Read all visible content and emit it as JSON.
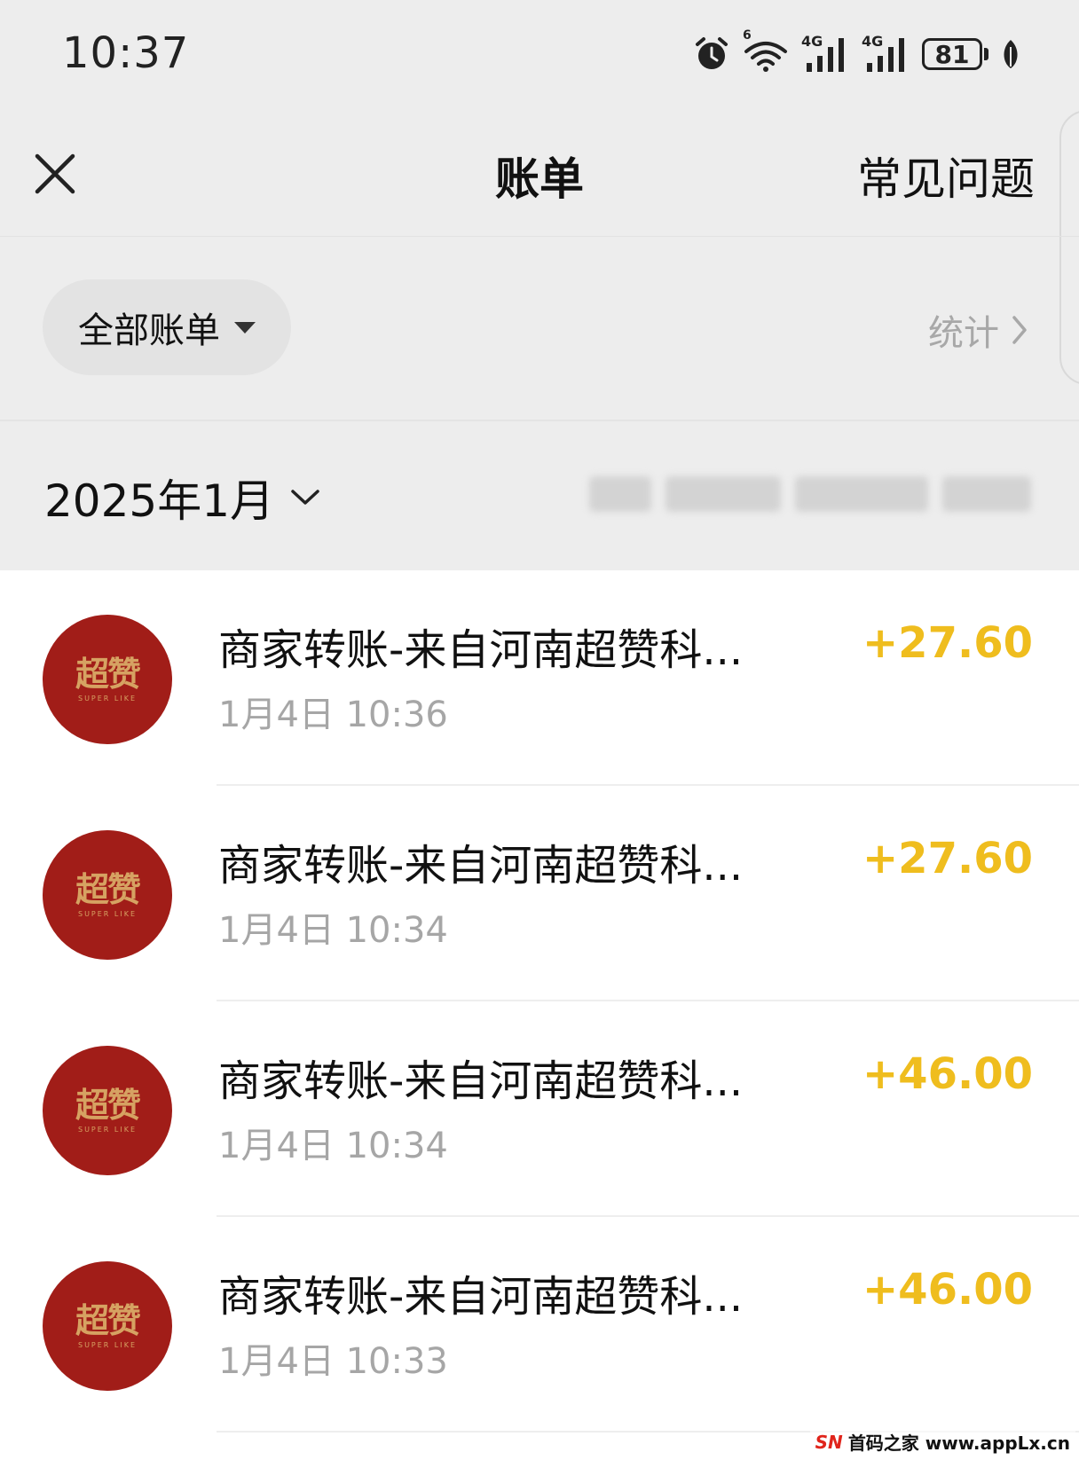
{
  "status_bar": {
    "time": "10:37",
    "battery": "81",
    "network_1": "4G",
    "network_2": "4G",
    "wifi_badge": "6"
  },
  "nav": {
    "title": "账单",
    "faq": "常见问题"
  },
  "filter": {
    "label": "全部账单",
    "stats": "统计"
  },
  "month": {
    "label": "2025年1月"
  },
  "bills": [
    {
      "title": "商家转账-来自河南超赞科...",
      "time": "1月4日 10:36",
      "amount": "+27.60"
    },
    {
      "title": "商家转账-来自河南超赞科...",
      "time": "1月4日 10:34",
      "amount": "+27.60"
    },
    {
      "title": "商家转账-来自河南超赞科...",
      "time": "1月4日 10:34",
      "amount": "+46.00"
    },
    {
      "title": "商家转账-来自河南超赞科...",
      "time": "1月4日 10:33",
      "amount": "+46.00"
    }
  ],
  "avatar": {
    "logo_text": "超赞",
    "logo_sub": "SUPER LIKE"
  },
  "watermark": {
    "brand": "SN",
    "text": "首码之家 www.appLx.cn"
  },
  "colors": {
    "amount": "#efbd1e",
    "avatar_bg": "#a11d18",
    "page_bg": "#ededed"
  }
}
